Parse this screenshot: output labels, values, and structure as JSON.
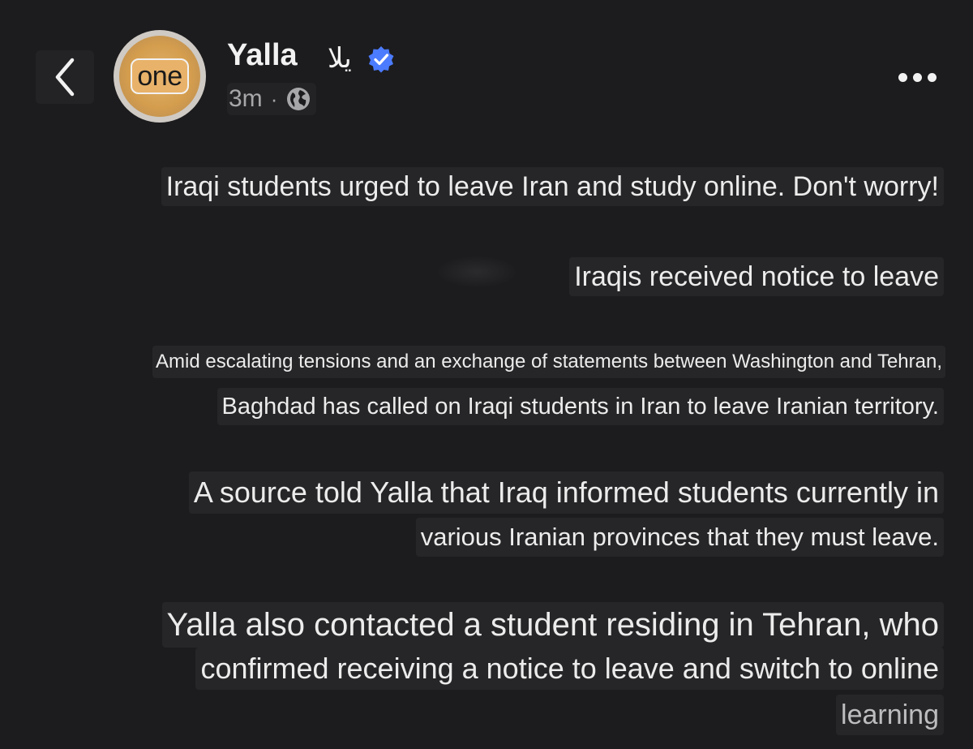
{
  "header": {
    "account_name": "Yalla",
    "account_name_arabic": "يلا",
    "avatar_logo_text": "one",
    "post_time": "3m",
    "separator": "·",
    "audience_icon": "globe-icon",
    "verified_icon": "verified-badge-icon",
    "back_icon": "chevron-left-icon",
    "more_icon": "more-horizontal-icon",
    "verified_color": "#4b7bff"
  },
  "post": {
    "headline": "Iraqi students urged to leave Iran and study online. Don't worry!",
    "subheadline": "Iraqis received notice to leave",
    "paragraph1_line1": "Amid escalating tensions and an exchange of statements between Washington and Tehran,",
    "paragraph1_line2": "Baghdad has called on Iraqi students in Iran to leave Iranian territory.",
    "paragraph2_line1": "A source told Yalla that Iraq informed students currently in",
    "paragraph2_line2": "various Iranian provinces that they must leave.",
    "paragraph3_line1": "Yalla also contacted a student residing in Tehran, who",
    "paragraph3_line2": "confirmed receiving a notice to leave and switch to online",
    "paragraph3_line3": "learning"
  },
  "colors": {
    "background": "#1c1c1e",
    "text": "#ececec",
    "muted": "#a7a7aa"
  }
}
